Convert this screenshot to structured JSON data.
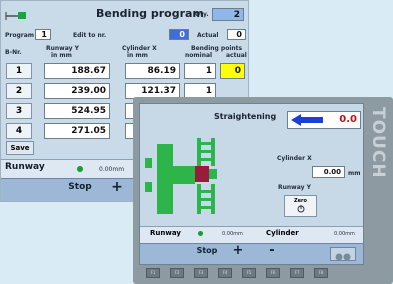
{
  "back": {
    "title": "Bending program",
    "qty_label": "Qty.",
    "qty_value": "2",
    "program_label": "Program no.",
    "program_value": "1",
    "edit_label": "Edit to nr.",
    "edit_value": "0",
    "actual_label": "Actual",
    "actual_value": "0",
    "col_bnr": "B-Nr.",
    "col_runway": "Runway Y",
    "col_runway_unit": "in   mm",
    "col_cylinder": "Cylinder X",
    "col_cylinder_unit": "in   mm",
    "col_bending": "Bending points",
    "col_nominal": "nominal",
    "col_actual": "actual",
    "rows": [
      {
        "n": "1",
        "runway": "188.67",
        "cylinder": "86.19",
        "nominal": "1",
        "actual": "0"
      },
      {
        "n": "2",
        "runway": "239.00",
        "cylinder": "121.37",
        "nominal": "1",
        "actual": ""
      },
      {
        "n": "3",
        "runway": "524.95",
        "cylinder": "",
        "nominal": "",
        "actual": ""
      },
      {
        "n": "4",
        "runway": "271.05",
        "cylinder": "",
        "nominal": "",
        "actual": ""
      }
    ],
    "save_label": "Save",
    "status_runway": "Runway",
    "status_value": "0.00mm",
    "stop_label": "Stop",
    "plus_label": "+"
  },
  "front": {
    "title": "Straightening",
    "value": "0.0",
    "cylinder_label": "Cylinder X",
    "cylinder_value": "0.00",
    "cylinder_unit": "mm",
    "runway_label": "Runway Y",
    "zero_label": "Zero",
    "status_runway": "Runway",
    "status_runway_value": "0.00mm",
    "status_cylinder": "Cylinder",
    "status_cylinder_value": "0.00mm",
    "stop_label": "Stop",
    "plus_label": "+",
    "minus_label": "-",
    "touch": "TOUCH",
    "fkeys": [
      "F1",
      "F2",
      "F3",
      "F4",
      "F5",
      "F6",
      "F7",
      "F8"
    ]
  },
  "colors": {
    "accent_yellow": "#ffff00",
    "arrow_blue": "#1c3fd6",
    "led_green": "#1a9b2e",
    "machine_green": "#2db54a",
    "machine_red": "#9a1c3c"
  }
}
